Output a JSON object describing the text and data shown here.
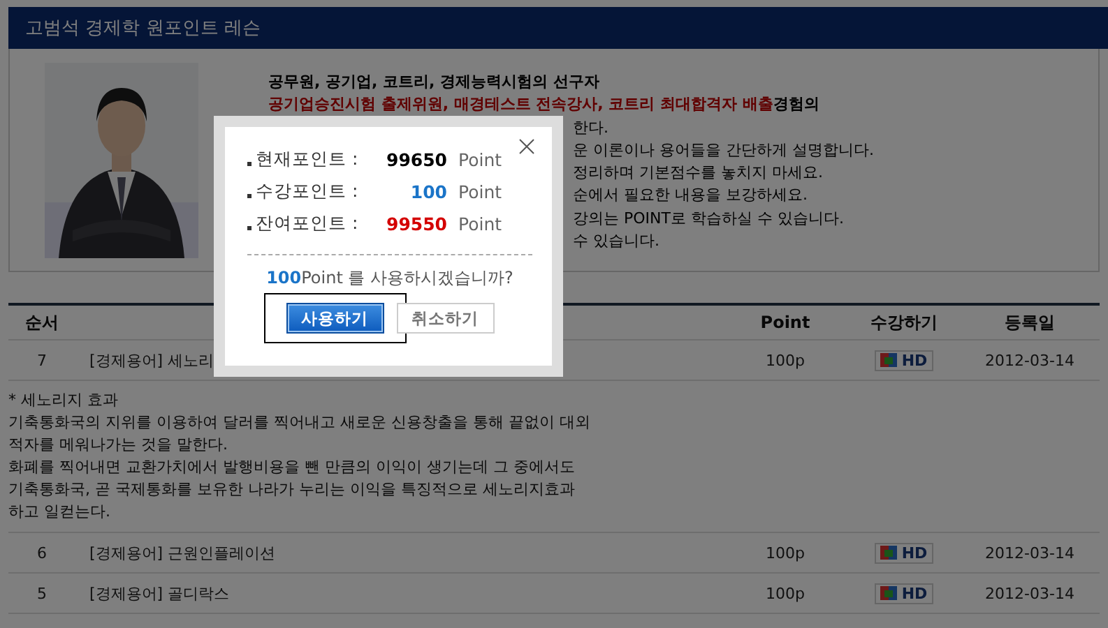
{
  "page_title": "고범석 경제학 원포인트 레슨",
  "intro": {
    "lines": [
      {
        "kind": "full",
        "text": "공무원, 공기업, 코트리, 경제능력시험의 선구자"
      },
      {
        "kind": "full",
        "text": "**공기업승진시험 출제위원, 매경테스트 전속강사, 코트리 최대합격자 배출**경험의"
      },
      {
        "kind": "partial",
        "text": "한다."
      },
      {
        "kind": "partial",
        "text": "운 이론이나 용어들을 간단하게 설명합니다."
      },
      {
        "kind": "partial",
        "text": "정리하며 기본점수를 놓치지 마세요."
      },
      {
        "kind": "partial",
        "text": "순에서 필요한 내용을 보강하세요."
      },
      {
        "kind": "partial",
        "text": "강의는 POINT로 학습하실 수 있습니다."
      },
      {
        "kind": "partial",
        "text": "수 있습니다."
      }
    ]
  },
  "table": {
    "columns": [
      "순서",
      "Point",
      "수강하기",
      "등록일"
    ],
    "rows": [
      {
        "number": "7",
        "title": "[경제용어] 세노리",
        "point": "100p",
        "quality": "HD",
        "date": "2012-03-14",
        "detail": [
          "* 세노리지 효과",
          "기축통화국의 지위를 이용하여 달러를 찍어내고 새로운 신용창출을 통해 끝없이 대외",
          "적자를 메워나가는 것을 말한다.",
          "화폐를 찍어내면 교환가치에서 발행비용을 뺀 만큼의 이익이 생기는데 그 중에서도",
          "기축통화국, 곧 국제통화를 보유한 나라가 누리는 이익을 특징적으로 세노리지효과",
          "하고 일컫는다."
        ]
      },
      {
        "number": "6",
        "title": "[경제용어] 근원인플레이션",
        "point": "100p",
        "quality": "HD",
        "date": "2012-03-14"
      },
      {
        "number": "5",
        "title": "[경제용어] 골디락스",
        "point": "100p",
        "quality": "HD",
        "date": "2012-03-14"
      }
    ]
  },
  "modal": {
    "rows": [
      {
        "label": "현재포인트 :",
        "value": "99650",
        "unit": "Point",
        "color": "#000000"
      },
      {
        "label": "수강포인트 :",
        "value": "100",
        "unit": "Point",
        "color": "#1a74c8"
      },
      {
        "label": "잔여포인트 :",
        "value": "99550",
        "unit": "Point",
        "color": "#d40000"
      }
    ],
    "question": {
      "amount": "100",
      "text": "Point 를 사용하시겠습니까?"
    },
    "buttons": [
      {
        "label": "사용하기",
        "kind": "primary",
        "focused": true
      },
      {
        "label": "취소하기",
        "kind": "secondary",
        "focused": false
      }
    ]
  }
}
